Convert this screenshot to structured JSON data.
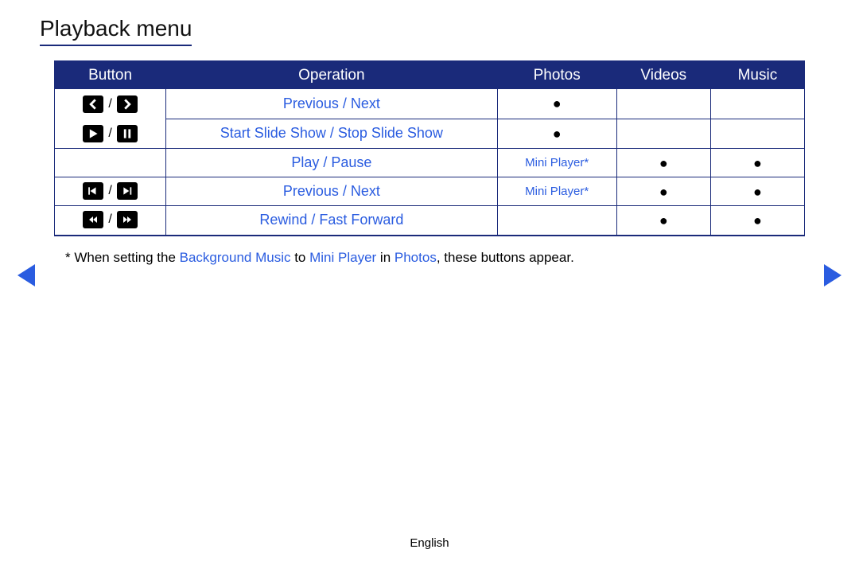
{
  "title": "Playback menu",
  "headers": {
    "button": "Button",
    "operation": "Operation",
    "photos": "Photos",
    "videos": "Videos",
    "music": "Music"
  },
  "rows": [
    {
      "operation": "Previous / Next",
      "photos": "●",
      "videos": "",
      "music": ""
    },
    {
      "operation": "Start Slide Show / Stop Slide Show",
      "photos": "●",
      "videos": "",
      "music": ""
    },
    {
      "operation": "Play / Pause",
      "photos": "Mini Player*",
      "videos": "●",
      "music": "●"
    },
    {
      "operation": "Previous / Next",
      "photos": "Mini Player*",
      "videos": "●",
      "music": "●"
    },
    {
      "operation": "Rewind / Fast Forward",
      "photos": "",
      "videos": "●",
      "music": "●"
    }
  ],
  "footnote": {
    "prefix": "* When setting the ",
    "bg_music": "Background Music",
    "to": " to ",
    "mini_player": "Mini Player",
    "in": " in ",
    "photos": "Photos",
    "suffix": ", these buttons appear."
  },
  "footer": "English"
}
